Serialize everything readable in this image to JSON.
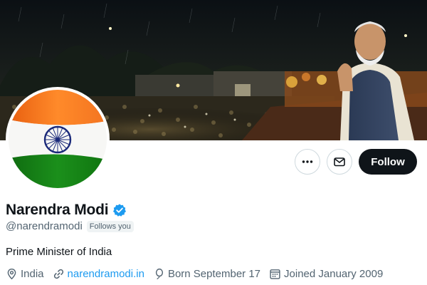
{
  "profile": {
    "display_name": "Narendra Modi",
    "verified_icon": "verified-badge-icon",
    "handle": "@narendramodi",
    "follows_you_label": "Follows you",
    "bio": "Prime Minister of India",
    "location": "India",
    "website": "narendramodi.in",
    "birthday": "Born September 17",
    "joined": "Joined January 2009"
  },
  "actions": {
    "more_icon": "more-options-icon",
    "message_icon": "envelope-icon",
    "follow_label": "Follow"
  },
  "icons": {
    "location": "location-pin-icon",
    "website": "link-icon",
    "birthday": "balloon-icon",
    "joined": "calendar-icon"
  },
  "colors": {
    "follow_button_bg": "#0f1419",
    "link": "#1d9bf0",
    "verified": "#1d9bf0",
    "secondary_text": "#536471",
    "saffron": "#ff7f1f",
    "flag_green": "#138808",
    "chakra_blue": "#000080"
  }
}
